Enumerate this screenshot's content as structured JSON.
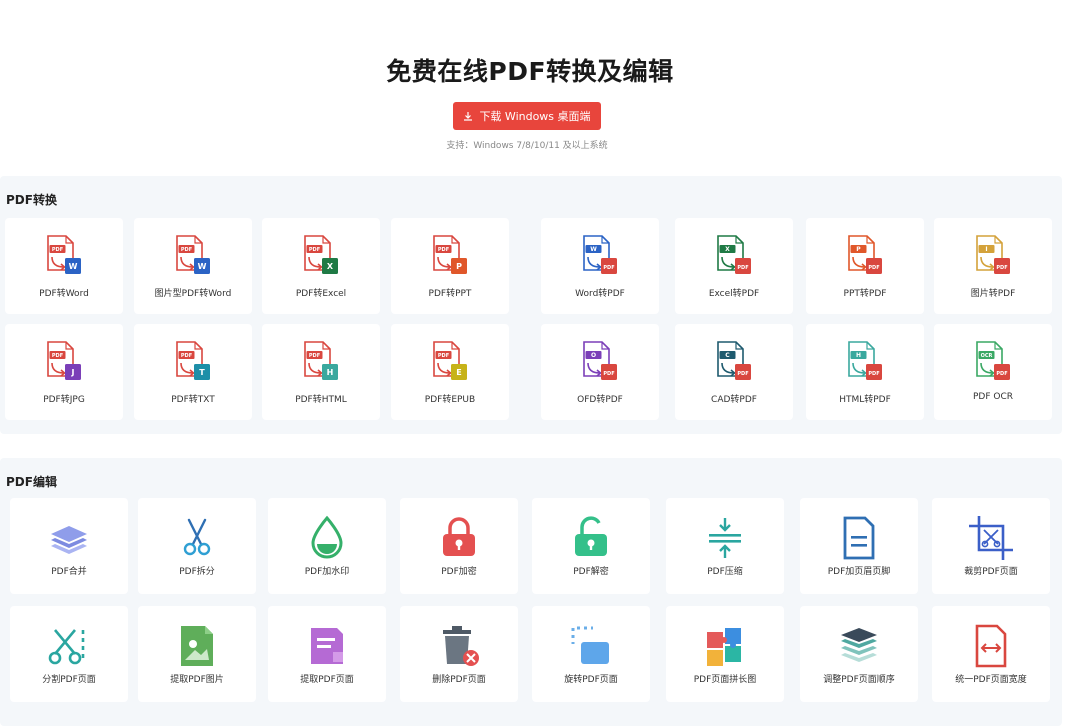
{
  "hero": {
    "title": "免费在线PDF转换及编辑",
    "download_label": "下载 Windows 桌面端",
    "support_text": "支持：Windows 7/8/10/11 及以上系统"
  },
  "convert": {
    "title": "PDF转换",
    "items": [
      {
        "label": "PDF转Word",
        "icon": "pdf-to-word-icon",
        "badge": "W",
        "color": "#2b63c5"
      },
      {
        "label": "图片型PDF转Word",
        "icon": "image-pdf-to-word-icon",
        "badge": "W",
        "color": "#2b63c5"
      },
      {
        "label": "PDF转Excel",
        "icon": "pdf-to-excel-icon",
        "badge": "X",
        "color": "#1f7a45"
      },
      {
        "label": "PDF转PPT",
        "icon": "pdf-to-ppt-icon",
        "badge": "P",
        "color": "#e0572a"
      },
      {
        "label": "Word转PDF",
        "icon": "word-to-pdf-icon",
        "badge": "W",
        "color": "#2b63c5"
      },
      {
        "label": "Excel转PDF",
        "icon": "excel-to-pdf-icon",
        "badge": "X",
        "color": "#1f7a45"
      },
      {
        "label": "PPT转PDF",
        "icon": "ppt-to-pdf-icon",
        "badge": "P",
        "color": "#e0572a"
      },
      {
        "label": "图片转PDF",
        "icon": "image-to-pdf-icon",
        "badge": "I",
        "color": "#d4a23a"
      },
      {
        "label": "PDF转JPG",
        "icon": "pdf-to-jpg-icon",
        "badge": "J",
        "color": "#7b3fb8"
      },
      {
        "label": "PDF转TXT",
        "icon": "pdf-to-txt-icon",
        "badge": "T",
        "color": "#1d8fa8"
      },
      {
        "label": "PDF转HTML",
        "icon": "pdf-to-html-icon",
        "badge": "H",
        "color": "#3aa89e"
      },
      {
        "label": "PDF转EPUB",
        "icon": "pdf-to-epub-icon",
        "badge": "E",
        "color": "#c7b319"
      },
      {
        "label": "OFD转PDF",
        "icon": "ofd-to-pdf-icon",
        "badge": "O",
        "color": "#7b3fb8"
      },
      {
        "label": "CAD转PDF",
        "icon": "cad-to-pdf-icon",
        "badge": "C",
        "color": "#1e5a6e"
      },
      {
        "label": "HTML转PDF",
        "icon": "html-to-pdf-icon",
        "badge": "H",
        "color": "#3aa89e"
      },
      {
        "label": "PDF OCR",
        "icon": "pdf-ocr-icon",
        "badge": "OCR",
        "color": "#3aa864"
      }
    ]
  },
  "edit": {
    "title": "PDF编辑",
    "items": [
      {
        "label": "PDF合并",
        "icon": "merge-layers-icon"
      },
      {
        "label": "PDF拆分",
        "icon": "scissors-icon"
      },
      {
        "label": "PDF加水印",
        "icon": "water-drop-icon"
      },
      {
        "label": "PDF加密",
        "icon": "lock-icon"
      },
      {
        "label": "PDF解密",
        "icon": "unlock-icon"
      },
      {
        "label": "PDF压缩",
        "icon": "compress-icon"
      },
      {
        "label": "PDF加页眉页脚",
        "icon": "header-footer-icon"
      },
      {
        "label": "裁剪PDF页面",
        "icon": "crop-icon"
      },
      {
        "label": "分割PDF页面",
        "icon": "split-page-icon"
      },
      {
        "label": "提取PDF图片",
        "icon": "extract-image-icon"
      },
      {
        "label": "提取PDF页面",
        "icon": "extract-page-icon"
      },
      {
        "label": "删除PDF页面",
        "icon": "delete-page-icon"
      },
      {
        "label": "旋转PDF页面",
        "icon": "rotate-page-icon"
      },
      {
        "label": "PDF页面拼长图",
        "icon": "puzzle-icon"
      },
      {
        "label": "调整PDF页面顺序",
        "icon": "reorder-layers-icon"
      },
      {
        "label": "统一PDF页面宽度",
        "icon": "uniform-width-icon"
      }
    ]
  }
}
